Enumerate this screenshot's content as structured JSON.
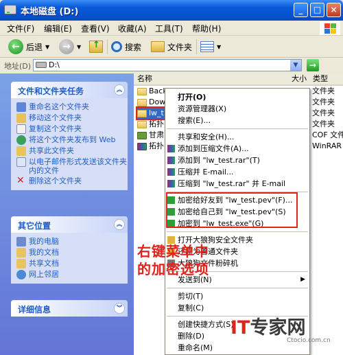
{
  "window": {
    "title": "本地磁盘 (D:)",
    "minimize": "_",
    "maximize": "□",
    "close": "×"
  },
  "menubar": [
    "文件(F)",
    "编辑(E)",
    "查看(V)",
    "收藏(A)",
    "工具(T)",
    "帮助(H)"
  ],
  "toolbar": {
    "back": "后退",
    "search": "搜索",
    "folders": "文件夹"
  },
  "address": {
    "label": "地址(D)",
    "value": "D:\\"
  },
  "tasks_panel": {
    "title": "文件和文件夹任务",
    "items": [
      "重命名这个文件夹",
      "移动这个文件夹",
      "复制这个文件夹",
      "将这个文件夹发布到 Web",
      "共享此文件夹",
      "以电子邮件形式发送该文件夹内的文件",
      "删除这个文件夹"
    ]
  },
  "places_panel": {
    "title": "其它位置",
    "items": [
      "我的电脑",
      "我的文档",
      "共享文档",
      "网上邻居"
    ]
  },
  "details_panel": {
    "title": "详细信息"
  },
  "columns": {
    "name": "名称",
    "size": "大小",
    "type": "类型"
  },
  "files": [
    {
      "name": "Back",
      "type": "文件夹"
    },
    {
      "name": "Down",
      "type": "文件夹"
    },
    {
      "name": "lw_t",
      "type": "文件夹"
    },
    {
      "name": "拓扑",
      "type": "文件夹"
    },
    {
      "name": "甘肃",
      "type": "COF 文件"
    },
    {
      "name": "拓扑",
      "type": "WinRAR 压"
    }
  ],
  "context_menu": [
    "打开(O)",
    "资源管理器(X)",
    "搜索(E)...",
    "共享和安全(H)...",
    "添加到压缩文件(A)...",
    "添加到 \"lw_test.rar\"(T)",
    "压缩并 E-mail...",
    "压缩到 \"lw_test.rar\" 并 E-mail",
    "加密给好友到 \"lw_test.pev\"(F)...",
    "加密给自己到 \"lw_test.pev\"(S)",
    "加密到 \"lw_test.exe\"(G)",
    "打开大狼狗安全文件夹",
    "还原为普通文件夹",
    "大狼狗文件粉碎机",
    "发送到(N)",
    "剪切(T)",
    "复制(C)",
    "创建快捷方式(S)",
    "删除(D)",
    "重命名(M)"
  ],
  "annotation": {
    "line1": "右键菜单中",
    "line2": "的加密选项"
  },
  "watermark": {
    "brand_it": "IT",
    "brand_rest": "专家网",
    "site": "Ctocio.com.cn"
  }
}
